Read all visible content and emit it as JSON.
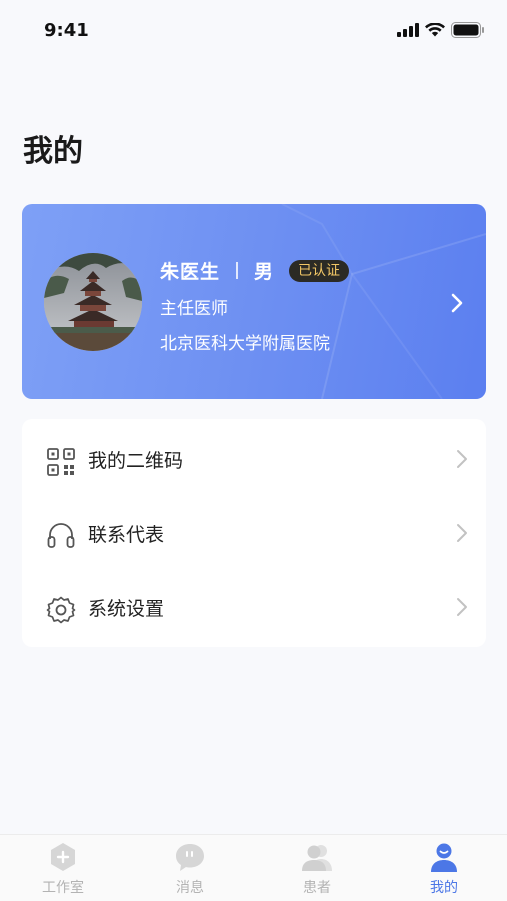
{
  "status_bar": {
    "time": "9:41"
  },
  "page": {
    "title": "我的"
  },
  "profile": {
    "name": "朱医生",
    "gender": "男",
    "verified_badge": "已认证",
    "title": "主任医师",
    "hospital": "北京医科大学附属医院"
  },
  "menu": {
    "items": [
      {
        "label": "我的二维码",
        "icon": "qr-code-icon"
      },
      {
        "label": "联系代表",
        "icon": "headset-icon"
      },
      {
        "label": "系统设置",
        "icon": "gear-icon"
      }
    ]
  },
  "tab_bar": {
    "tabs": [
      {
        "label": "工作室",
        "icon": "hexagon-plus-icon",
        "active": false
      },
      {
        "label": "消息",
        "icon": "chat-bubble-icon",
        "active": false
      },
      {
        "label": "患者",
        "icon": "patients-icon",
        "active": false
      },
      {
        "label": "我的",
        "icon": "person-icon",
        "active": true
      }
    ],
    "colors": {
      "active": "#4c77e6",
      "inactive": "#b3b3b3"
    }
  },
  "colors": {
    "card_gradient_start": "#7ea0f6",
    "card_gradient_end": "#5b7ff0",
    "badge_bg": "#2b2a25",
    "badge_text": "#f2c766"
  }
}
